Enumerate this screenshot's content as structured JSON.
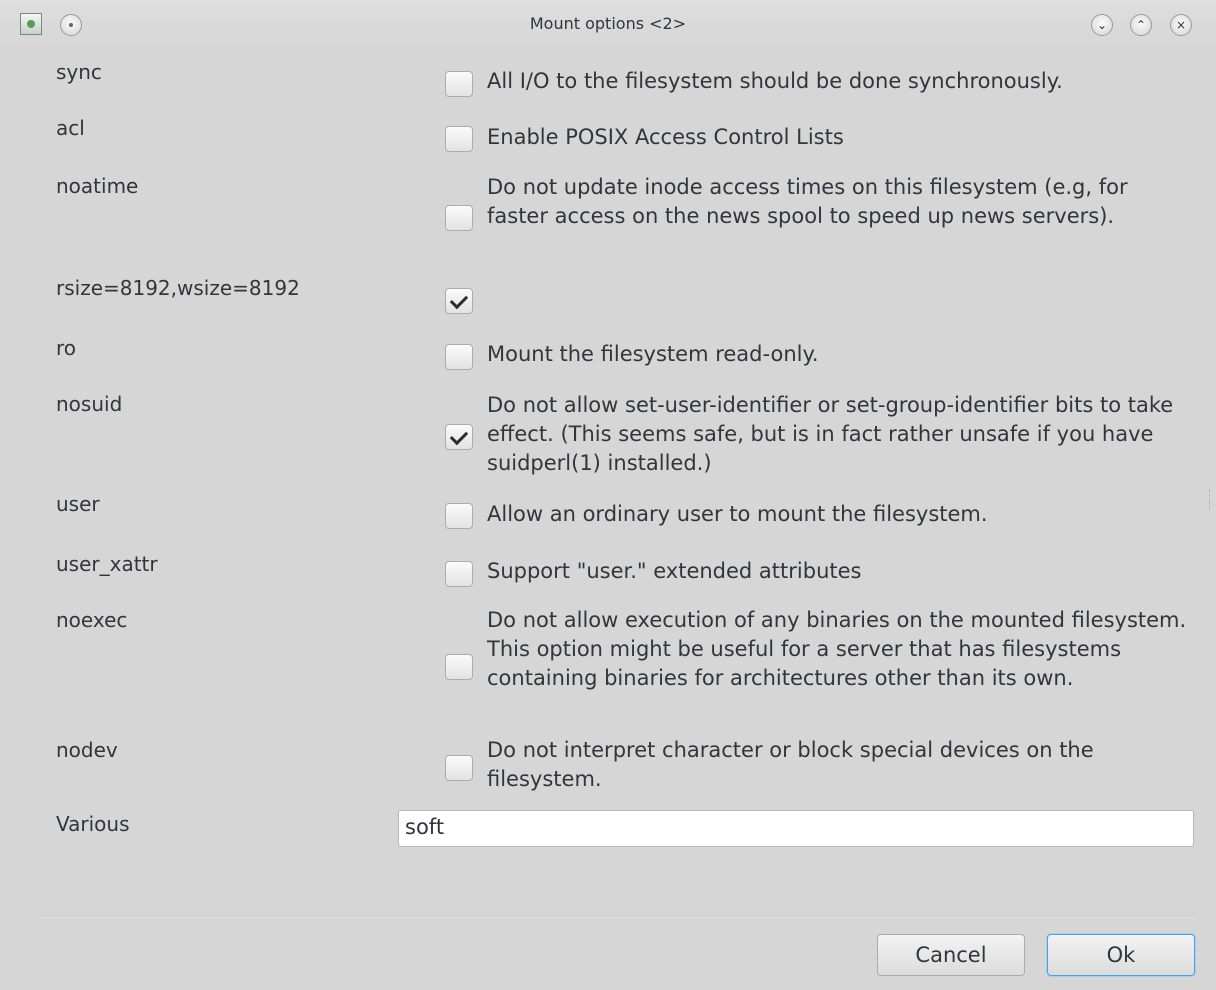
{
  "window": {
    "title": "Mount options <2>"
  },
  "options": [
    {
      "label": "sync",
      "checked": false,
      "description": "All I/O to the filesystem should be done synchronously."
    },
    {
      "label": "acl",
      "checked": false,
      "description": "Enable POSIX Access Control Lists"
    },
    {
      "label": "noatime",
      "checked": false,
      "description": "Do not update inode access times on this filesystem (e.g, for faster access on the news spool to speed up news servers)."
    },
    {
      "label": "rsize=8192,wsize=8192",
      "checked": true,
      "description": ""
    },
    {
      "label": "ro",
      "checked": false,
      "description": "Mount the filesystem read-only."
    },
    {
      "label": "nosuid",
      "checked": true,
      "description": "Do not allow set-user-identifier or set-group-identifier bits to take effect. (This seems safe, but is in fact rather unsafe if you have suidperl(1) installed.)"
    },
    {
      "label": "user",
      "checked": false,
      "description": "Allow an ordinary user to mount the filesystem."
    },
    {
      "label": "user_xattr",
      "checked": false,
      "description": "Support \"user.\" extended attributes"
    },
    {
      "label": "noexec",
      "checked": false,
      "description": "Do not allow execution of any binaries on the mounted filesystem. This option might be useful for a server that has filesystems containing binaries for architectures other than its own."
    },
    {
      "label": "nodev",
      "checked": false,
      "description": "Do not interpret character or block special devices on the filesystem."
    }
  ],
  "various": {
    "label": "Various",
    "value": "soft"
  },
  "buttons": {
    "cancel": "Cancel",
    "ok": "Ok"
  }
}
